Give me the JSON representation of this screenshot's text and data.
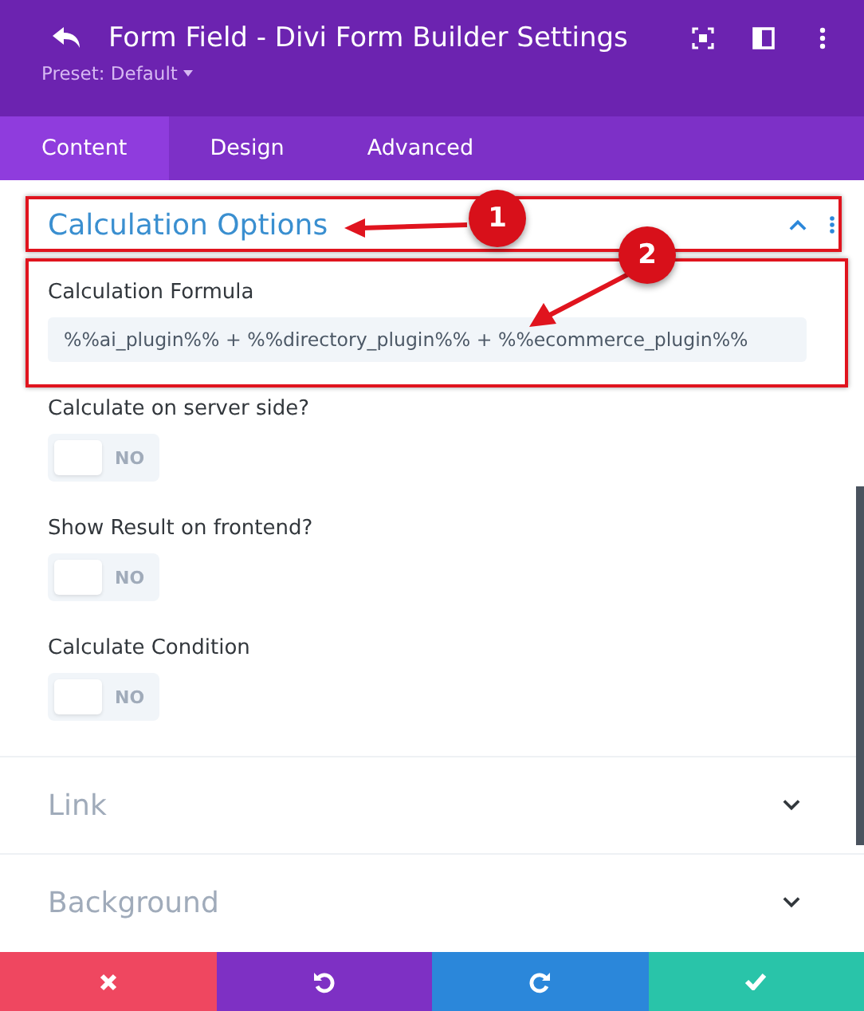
{
  "header": {
    "title": "Form Field - Divi Form Builder Settings",
    "preset": "Preset: Default"
  },
  "tabs": [
    {
      "label": "Content",
      "selected": true
    },
    {
      "label": "Design",
      "selected": false
    },
    {
      "label": "Advanced",
      "selected": false
    }
  ],
  "open_section": {
    "title": "Calculation Options",
    "expanded": true,
    "annotation": "1",
    "fields": [
      {
        "kind": "text",
        "label": "Calculation Formula",
        "value": "%%ai_plugin%% + %%directory_plugin%% + %%ecommerce_plugin%%",
        "annotation": "2"
      },
      {
        "kind": "toggle",
        "label": "Calculate on server side?",
        "on": false,
        "state_label": "NO"
      },
      {
        "kind": "toggle",
        "label": "Show Result on frontend?",
        "on": false,
        "state_label": "NO"
      },
      {
        "kind": "toggle",
        "label": "Calculate Condition",
        "on": false,
        "state_label": "NO"
      }
    ]
  },
  "sections": [
    {
      "title": "Link",
      "expanded": false
    },
    {
      "title": "Background",
      "expanded": false
    }
  ],
  "footer_buttons": [
    {
      "kind": "cancel"
    },
    {
      "kind": "undo"
    },
    {
      "kind": "redo"
    },
    {
      "kind": "save"
    }
  ]
}
